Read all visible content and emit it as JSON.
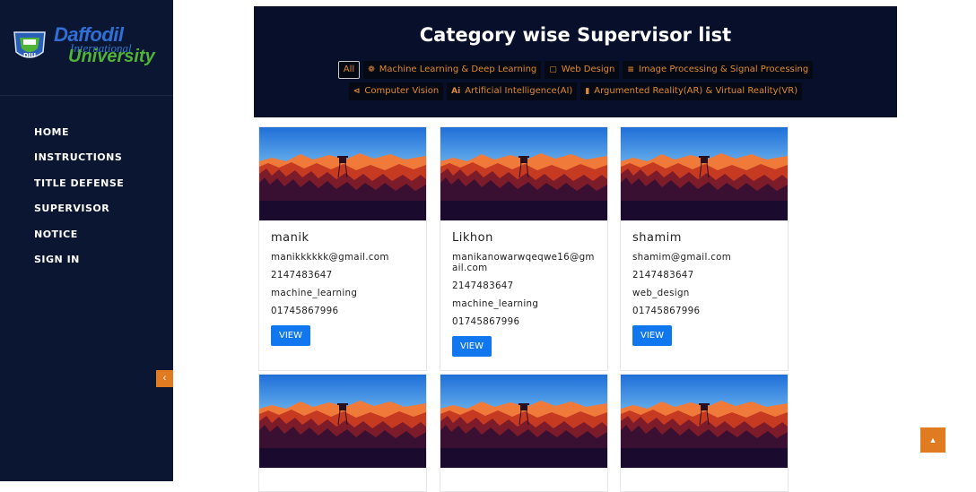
{
  "logo": {
    "line1": "Daffodil",
    "line2": "International",
    "line3": "University",
    "emblem_text": "DIU"
  },
  "sidebar": {
    "items": [
      {
        "label": "HOME"
      },
      {
        "label": "INSTRUCTIONS"
      },
      {
        "label": "TITLE DEFENSE"
      },
      {
        "label": "SUPERVISOR"
      },
      {
        "label": "NOTICE"
      },
      {
        "label": "SIGN IN"
      }
    ],
    "collapse_icon": "chevron-left-icon"
  },
  "banner": {
    "title": "Category wise Supervisor list",
    "filters": [
      {
        "label": "All",
        "icon": "",
        "active": true
      },
      {
        "label": "Machine Learning & Deep Learning",
        "icon": "gear-icon"
      },
      {
        "label": "Web Design",
        "icon": "document-icon"
      },
      {
        "label": "Image Processing & Signal Processing",
        "icon": "layers-icon"
      },
      {
        "label": "Computer Vision",
        "icon": "share-icon"
      },
      {
        "label": "Artificial Intelligence(AI)",
        "icon": "ai-icon"
      },
      {
        "label": "Argumented Reality(AR) & Virtual Reality(VR)",
        "icon": "signal-icon"
      }
    ]
  },
  "cards": [
    {
      "name": "manik",
      "email": "manikkkkkk@gmail.com",
      "id": "2147483647",
      "category": "machine_learning",
      "phone": "01745867996",
      "button": "VIEW"
    },
    {
      "name": "Likhon",
      "email": "manikanowarwqeqwe16@gmail.com",
      "id": "2147483647",
      "category": "machine_learning",
      "phone": "01745867996",
      "button": "VIEW"
    },
    {
      "name": "shamim",
      "email": "shamim@gmail.com",
      "id": "2147483647",
      "category": "web_design",
      "phone": "01745867996",
      "button": "VIEW"
    }
  ],
  "colors": {
    "sidebar_bg": "#0b1632",
    "banner_bg": "#080f2a",
    "accent_orange": "#e07b22",
    "button_blue": "#1177ee"
  },
  "scroll_top_icon": "caret-up-icon"
}
